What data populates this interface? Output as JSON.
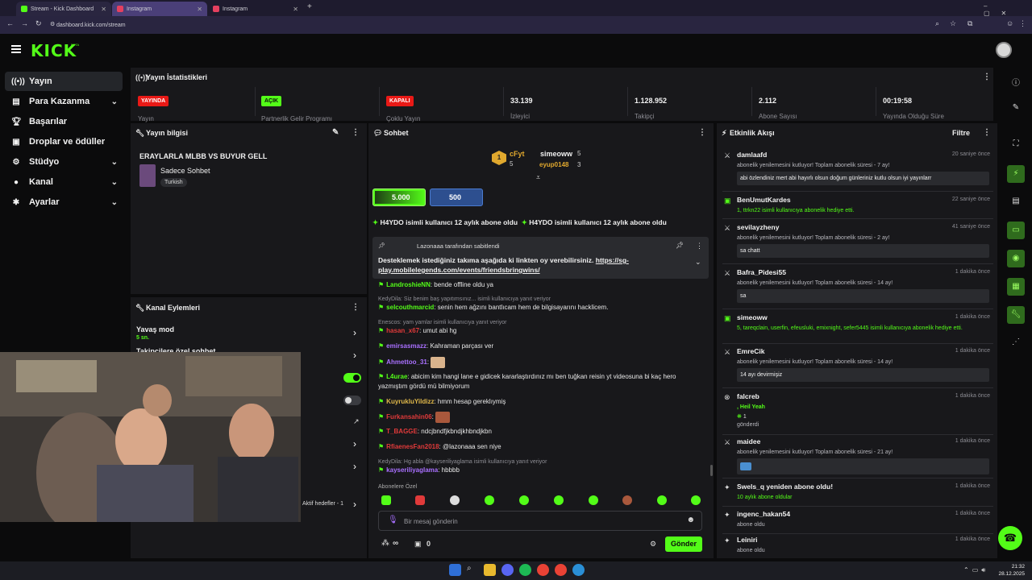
{
  "browser": {
    "tabs": [
      {
        "title": "Stream - Kick Dashboard"
      },
      {
        "title": "Instagram"
      },
      {
        "title": "Instagram"
      }
    ],
    "url": "dashboard.kick.com/stream"
  },
  "site": {
    "logo": "KICK",
    "beta": "BETA"
  },
  "nav": [
    {
      "label": "Yayın",
      "icon": "broadcast-icon"
    },
    {
      "label": "Para Kazanma",
      "icon": "money-icon"
    },
    {
      "label": "Başarılar",
      "icon": "trophy-icon"
    },
    {
      "label": "Droplar ve ödüller",
      "icon": "gift-icon"
    },
    {
      "label": "Stüdyo",
      "icon": "settings-icon"
    },
    {
      "label": "Kanal",
      "icon": "user-icon"
    },
    {
      "label": "Ayarlar",
      "icon": "gear-icon"
    }
  ],
  "stats": {
    "title": "Yayın İstatistikleri",
    "badges": [
      {
        "text": "YAYINDA",
        "label": "Yayın"
      },
      {
        "text": "AÇIK",
        "label": "Partnerlik Gelir Programı"
      },
      {
        "text": "KAPALI",
        "label": "Çoklu Yayın"
      }
    ],
    "numbers": [
      {
        "value": "33.139",
        "label": "İzleyici"
      },
      {
        "value": "1.128.952",
        "label": "Takipçi"
      },
      {
        "value": "2.112",
        "label": "Abone Sayısı"
      },
      {
        "value": "00:19:58",
        "label": "Yayında Olduğu Süre"
      }
    ]
  },
  "info": {
    "title": "Yayın bilgisi",
    "stream_title": "ERAYLARLA MLBB VS BUYUR GELL",
    "category": "Sadece Sohbet",
    "tag": "Turkish"
  },
  "actions": {
    "title": "Kanal Eylemleri",
    "slow": "Yavaş mod",
    "slow_val": "5 sn.",
    "followers": "Takipçilere özel sohbet",
    "goals": "Aktif hedefler - 1"
  },
  "chat": {
    "title": "Sohbet",
    "top": [
      {
        "name": "cFyt",
        "count": ""
      },
      {
        "name": "simeoww",
        "count": "5"
      },
      {
        "name": "eyup0148",
        "count": "3"
      }
    ],
    "top_count": "5",
    "goal1": "5.000",
    "goal2": "500",
    "ticker": "H4YDO isimli kullanıcı 12 aylık abone oldu",
    "pinned_by": "Lazonaaa tarafından sabitlendi",
    "pinned": "Desteklemek istediğiniz takıma aşağıda ki linkten oy verebilirsiniz.",
    "pinned_link": "https://sg-play.mobilelegends.com/events/friendsbringwins/",
    "messages": [
      {
        "user": "LandroshieNN",
        "color": "#53fc18",
        "text": "bende offline oldu ya"
      },
      {
        "reply": "KedyDila: Siz benim baş yapıtımsınız... isimli kullanıcıya yanıt veriyor"
      },
      {
        "user": "selcouthmarcid",
        "color": "#53fc18",
        "text": "senin hem ağzını bantlıcam hem de bilgisayarını hacklicem."
      },
      {
        "reply": "Enescos: yam yamlar isimli kullanıcıya yanıt veriyor"
      },
      {
        "user": "hasan_x67",
        "color": "#e03a3a",
        "text": "umut abi hg"
      },
      {
        "user": "emirsasmazz",
        "color": "#a970ff",
        "text": "Kahraman parçası ver"
      },
      {
        "user": "Ahmettoo_31",
        "color": "#a970ff",
        "text": ""
      },
      {
        "user": "L4urae",
        "color": "#53fc18",
        "text": "abicim kim hangi lane e gidicek kararlaştırdınız mı ben tuğkan reisin yt videosuna bi kaç hero yazmıştım gördü mü bilmiyorum"
      },
      {
        "user": "KuyrukluYildizz",
        "color": "#e0b84a",
        "text": "hmm hesap gereklıymiş"
      },
      {
        "user": "Furkansahin06",
        "color": "#e03a3a",
        "text": ""
      },
      {
        "user": "T_BAGGE",
        "color": "#e03a3a",
        "text": "ndcjbndfjkbndjkhbndjkbn"
      },
      {
        "user": "RfiaenesFan2018",
        "color": "#e03a3a",
        "text": "@lazonaaa sen niye"
      },
      {
        "reply": "KedyDila: Hg abla @kayseriliyaglama isimli kullanıcıya yanıt veriyor"
      },
      {
        "user": "kayseriliyaglama",
        "color": "#a970ff",
        "text": "hbbbb"
      }
    ],
    "subs_only": "Abonelere Özel",
    "placeholder": "Bir mesaj gönderin",
    "send": "Gönder",
    "infinity": "∞",
    "zero": "0"
  },
  "activity": {
    "title": "Etkinlik Akışı",
    "filter": "Filtre",
    "items": [
      {
        "name": "damlaafd",
        "time": "20 saniye önce",
        "desc": "abonelik yenilemesini kutluyor! Toplam abonelik süresi - 7 ay!",
        "msg": "abi özlendiniz mert abi hayırlı olsun doğum günleriniz kutlu olsun iyi yayınlarr"
      },
      {
        "name": "BenUmutKardes",
        "time": "22 saniye önce",
        "desc": "1, ttrkn22 isimli kullanıcıya abonelik hediye etti.",
        "msg": ""
      },
      {
        "name": "sevilayzheny",
        "time": "41 saniye önce",
        "desc": "abonelik yenilemesini kutluyor! Toplam abonelik süresi - 2 ay!",
        "msg": "sa chatt"
      },
      {
        "name": "Bafra_Pidesi55",
        "time": "1 dakika önce",
        "desc": "abonelik yenilemesini kutluyor! Toplam abonelik süresi - 14 ay!",
        "msg": "sa"
      },
      {
        "name": "simeoww",
        "time": "1 dakika önce",
        "desc": "5, tareqclain, userfin, efeusluki, emixnight, sefer5445 isimli kullanıcıya abonelik hediye etti.",
        "msg": ""
      },
      {
        "name": "EmreCik",
        "time": "1 dakika önce",
        "desc": "abonelik yenilemesini kutluyor! Toplam abonelik süresi - 14 ay!",
        "msg": "14 ayı devirmişiz"
      },
      {
        "name": "falcreb",
        "time": "1 dakika önce",
        "desc": ", Heil Yeah",
        "msg": ""
      },
      {
        "name": "maidee",
        "time": "1 dakika önce",
        "desc": "abonelik yenilemesini kutluyor! Toplam abonelik süresi - 21 ay!",
        "msg": ""
      },
      {
        "name": "Swels_q yeniden abone oldu!",
        "time": "1 dakika önce",
        "desc": "10 aylık abone oldular",
        "msg": ""
      },
      {
        "name": "ingenc_hakan54",
        "time": "1 dakika önce",
        "desc": "abone oldu",
        "msg": ""
      },
      {
        "name": "Leiniri",
        "time": "1 dakika önce",
        "desc": "abone oldu",
        "msg": ""
      }
    ],
    "falcreb_count": "1",
    "falcreb_sent": "gönderdi"
  },
  "clock": {
    "time": "21:32",
    "date": "28.12.2025"
  },
  "colors": {
    "accent": "#53fc18",
    "live": "#e91916",
    "panel": "#18181b"
  }
}
